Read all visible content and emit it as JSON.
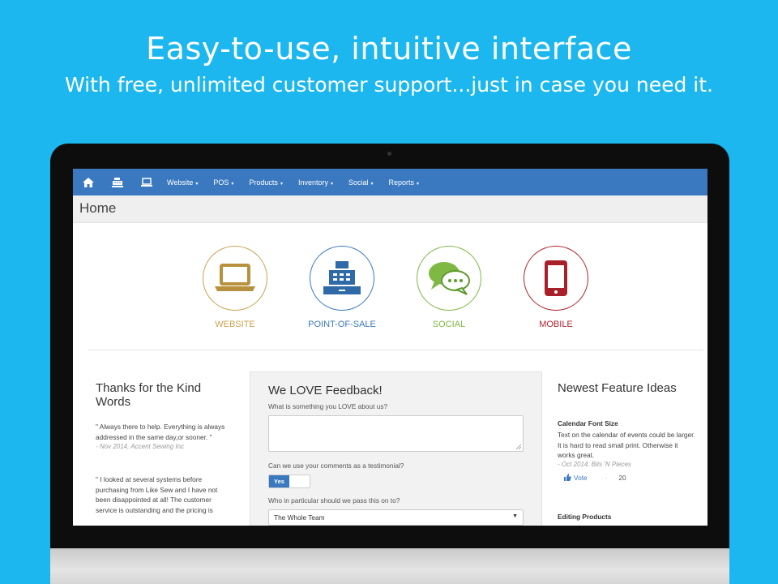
{
  "hero": {
    "headline": "Easy-to-use, intuitive interface",
    "subline": "With free, unlimited customer support...just in case you need it."
  },
  "navbar": {
    "icons": [
      "home-icon",
      "cash-register-icon",
      "laptop-icon"
    ],
    "items": [
      {
        "label": "Website"
      },
      {
        "label": "POS"
      },
      {
        "label": "Products"
      },
      {
        "label": "Inventory"
      },
      {
        "label": "Social"
      },
      {
        "label": "Reports"
      }
    ],
    "caret": "▾"
  },
  "page": {
    "title": "Home"
  },
  "modules": [
    {
      "label": "WEBSITE",
      "icon": "laptop-icon",
      "color": "#c9a253"
    },
    {
      "label": "POINT-OF-SALE",
      "icon": "cash-register-icon",
      "color": "#3a79bf"
    },
    {
      "label": "SOCIAL",
      "icon": "chat-bubbles-icon",
      "color": "#7fb844"
    },
    {
      "label": "MOBILE",
      "icon": "mobile-phone-icon",
      "color": "#b0242e"
    }
  ],
  "testimonials": {
    "title": "Thanks for the Kind Words",
    "items": [
      {
        "quote": "\" Always there to help. Everything is always addressed in the same day,or sooner. \"",
        "source": "- Nov 2014, Accent Sewing Inc"
      },
      {
        "quote": "\" I looked at several systems before purchasing from Like Sew and I have not been disappointed at all! The customer service is outstanding and the pricing is",
        "source": ""
      }
    ]
  },
  "feedback": {
    "title": "We LOVE Feedback!",
    "q1": "What is something you LOVE about us?",
    "q2": "Can we use your comments as a testimonial?",
    "toggle_yes": "Yes",
    "q3": "Who in particular should we pass this on to?",
    "select_value": "The Whole Team"
  },
  "features": {
    "title": "Newest Feature Ideas",
    "items": [
      {
        "title": "Calendar Font Size",
        "text": "Text on the calendar of events could be larger. It is hard to read small print. Otherwise it works great.",
        "source": "- Oct 2014, Bits 'N Pieces",
        "vote_label": "Vote",
        "votes": "20"
      },
      {
        "title": "Editing Products",
        "text": "",
        "source": "",
        "vote_label": "",
        "votes": ""
      }
    ]
  },
  "colors": {
    "background": "#1bb7ee",
    "navbar": "#3a79bf"
  }
}
